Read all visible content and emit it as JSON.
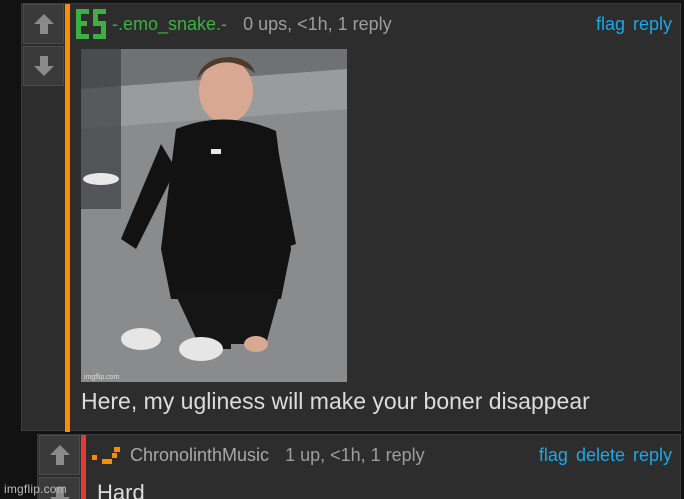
{
  "colors": {
    "accent_link": "#1ba7e8",
    "op_username": "#3cb043",
    "thread_bar_1": "#ff8c00",
    "thread_bar_2": "#e53935"
  },
  "comments": [
    {
      "username": "-.emo_snake.-",
      "avatar_icon": "user-flair-ES-icon",
      "meta": "0 ups, <1h, 1 reply",
      "actions": [
        "flag",
        "reply"
      ],
      "image_watermark": "imgflip.com",
      "text": "Here, my ugliness will make your boner disappear"
    },
    {
      "username": "ChronolinthMusic",
      "avatar_icon": "user-flair-pixel-icon",
      "meta": "1 up, <1h, 1 reply",
      "actions": [
        "flag",
        "delete",
        "reply"
      ],
      "text": "Hard"
    }
  ],
  "watermark": "imgflip.com"
}
